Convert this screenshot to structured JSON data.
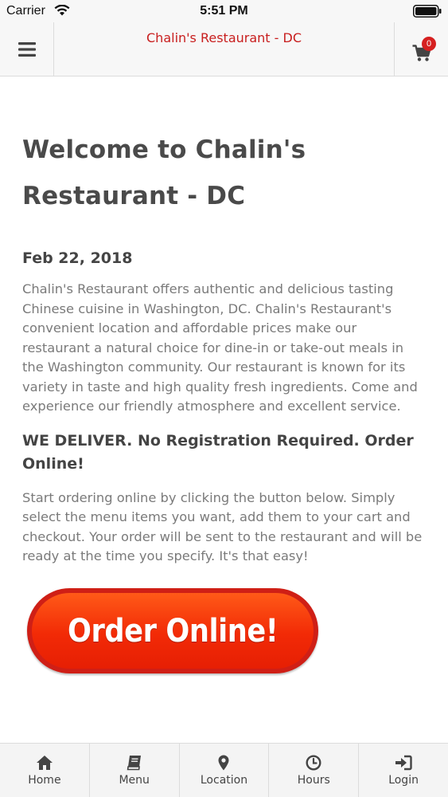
{
  "status_bar": {
    "carrier": "Carrier",
    "time": "5:51 PM"
  },
  "header": {
    "title": "Chalin's Restaurant - DC",
    "cart_count": "0",
    "title_color": "#c81e1e"
  },
  "main": {
    "title": "Welcome to Chalin's Restaurant - DC",
    "date": "Feb 22, 2018",
    "description": "Chalin's Restaurant offers authentic and delicious tasting Chinese cuisine in Washington, DC. Chalin's Restaurant's convenient location and affordable prices make our restaurant a natural choice for dine-in or take-out meals in the Washington community. Our restaurant is known for its variety in taste and high quality fresh ingredients. Come and experience our friendly atmosphere and excellent service.",
    "delivery_heading": "WE DELIVER. No Registration Required. Order Online!",
    "instructions": "Start ordering online by clicking the button below. Simply select the menu items you want, add them to your cart and checkout. Your order will be sent to the restaurant and will be ready at the time you specify. It's that easy!",
    "order_button_label": "Order Online!",
    "order_button_color": "#f22a06"
  },
  "bottom_nav": {
    "items": [
      {
        "label": "Home",
        "icon": "home-icon"
      },
      {
        "label": "Menu",
        "icon": "book-icon"
      },
      {
        "label": "Location",
        "icon": "map-pin-icon"
      },
      {
        "label": "Hours",
        "icon": "clock-icon"
      },
      {
        "label": "Login",
        "icon": "sign-in-icon"
      }
    ]
  }
}
